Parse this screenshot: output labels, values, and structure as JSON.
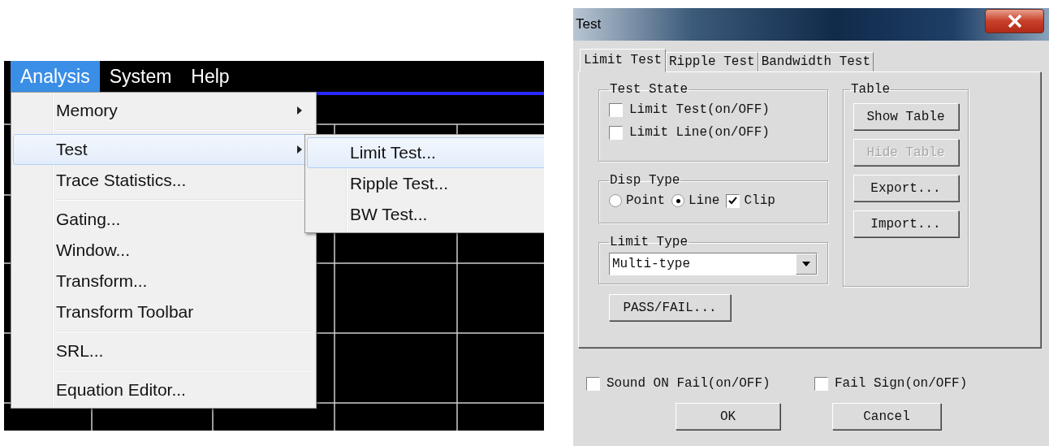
{
  "menubar": [
    {
      "label": "Analysis",
      "selected": true
    },
    {
      "label": "System",
      "selected": false
    },
    {
      "label": "Help",
      "selected": false
    }
  ],
  "menu": {
    "groups": [
      [
        {
          "label": "Memory",
          "has_submenu": true,
          "selected": false
        }
      ],
      [
        {
          "label": "Test",
          "has_submenu": true,
          "selected": true
        },
        {
          "label": "Trace Statistics...",
          "has_submenu": false,
          "selected": false
        }
      ],
      [
        {
          "label": "Gating...",
          "has_submenu": false,
          "selected": false
        },
        {
          "label": "Window...",
          "has_submenu": false,
          "selected": false
        },
        {
          "label": "Transform...",
          "has_submenu": false,
          "selected": false
        },
        {
          "label": "Transform Toolbar",
          "has_submenu": false,
          "selected": false
        }
      ],
      [
        {
          "label": "SRL...",
          "has_submenu": false,
          "selected": false
        }
      ],
      [
        {
          "label": "Equation Editor...",
          "has_submenu": false,
          "selected": false
        }
      ]
    ]
  },
  "submenu": {
    "items": [
      {
        "label": "Limit Test...",
        "selected": true
      },
      {
        "label": "Ripple Test...",
        "selected": false
      },
      {
        "label": "BW Test...",
        "selected": false
      }
    ]
  },
  "dialog": {
    "title": "Test",
    "tabs": [
      {
        "label": "Limit Test",
        "selected": true
      },
      {
        "label": "Ripple Test",
        "selected": false
      },
      {
        "label": "Bandwidth Test",
        "selected": false
      }
    ],
    "test_state": {
      "title": "Test State",
      "options": [
        {
          "label": "Limit Test(on/OFF)",
          "checked": false
        },
        {
          "label": "Limit Line(on/OFF)",
          "checked": false
        }
      ]
    },
    "disp_type": {
      "title": "Disp Type",
      "options": [
        {
          "kind": "radio",
          "label": "Point",
          "selected": false
        },
        {
          "kind": "radio",
          "label": "Line",
          "selected": true
        },
        {
          "kind": "checkbox",
          "label": "Clip",
          "checked": true
        }
      ]
    },
    "limit_type": {
      "title": "Limit Type",
      "value": "Multi-type"
    },
    "pass_fail_button": "PASS/FAIL...",
    "table": {
      "title": "Table",
      "buttons": [
        {
          "label": "Show Table",
          "disabled": false
        },
        {
          "label": "Hide Table",
          "disabled": true
        },
        {
          "label": "Export...",
          "disabled": false
        },
        {
          "label": "Import...",
          "disabled": false
        }
      ]
    },
    "bottom_options": [
      {
        "label": "Sound ON Fail(on/OFF)",
        "checked": false
      },
      {
        "label": "Fail Sign(on/OFF)",
        "checked": false
      }
    ],
    "buttons": [
      "OK",
      "Cancel"
    ]
  }
}
